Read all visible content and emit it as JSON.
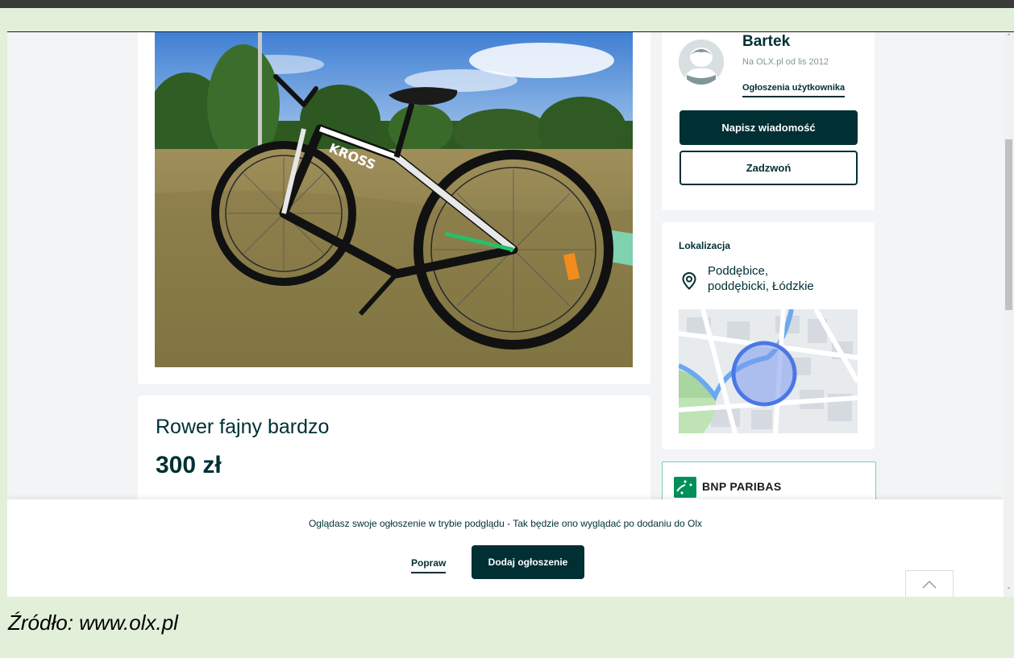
{
  "listing": {
    "title": "Rower fajny bardzo",
    "price": "300 zł",
    "photo_brand_text": "KROSS"
  },
  "seller": {
    "name": "Bartek",
    "member_since": "Na OLX.pl od lis 2012",
    "user_ads_link": "Ogłoszenia użytkownika",
    "message_button": "Napisz wiadomość",
    "call_button": "Zadzwoń"
  },
  "location": {
    "heading": "Lokalizacja",
    "line1": "Poddębice,",
    "line2": "poddębicki, Łódzkie"
  },
  "advertiser": {
    "name": "BNP PARIBAS"
  },
  "preview_bar": {
    "message": "Oglądasz swoje ogłoszenie w trybie podglądu - Tak będzie ono wyglądać po dodaniu do Olx",
    "edit_button": "Popraw",
    "publish_button": "Dodaj ogłoszenie"
  },
  "caption": "Źródło: www.olx.pl",
  "colors": {
    "brand_dark": "#002f34",
    "page_background": "#f2f4f5",
    "frame_green": "#e2efd9",
    "bnp_green": "#00915a"
  }
}
